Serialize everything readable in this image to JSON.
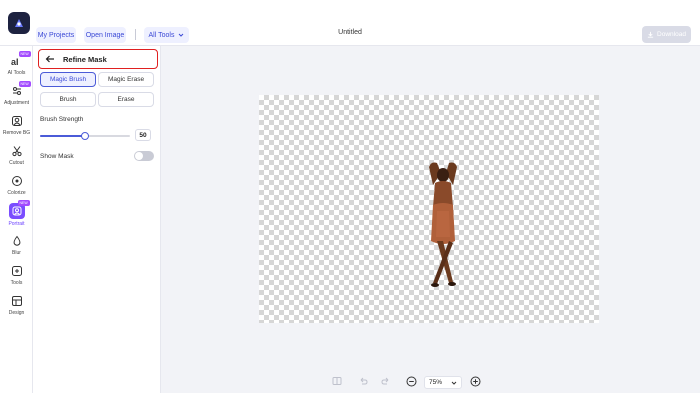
{
  "topbar": {
    "my_projects": "My Projects",
    "open_image": "Open Image",
    "all_tools": "All Tools",
    "doc_title": "Untitled",
    "download": "Download"
  },
  "nav": {
    "items": [
      {
        "label": "AI Tools",
        "icon": "ai-icon",
        "badge": "NEW"
      },
      {
        "label": "Adjustment",
        "icon": "sliders-icon",
        "badge": "NEW"
      },
      {
        "label": "Remove BG",
        "icon": "remove-bg-icon"
      },
      {
        "label": "Cutout",
        "icon": "scissors-icon"
      },
      {
        "label": "Colorize",
        "icon": "colorize-icon"
      },
      {
        "label": "Portrait",
        "icon": "portrait-icon",
        "badge": "NEW",
        "active": true
      },
      {
        "label": "Blur",
        "icon": "blur-icon"
      },
      {
        "label": "Tools",
        "icon": "tools-icon"
      },
      {
        "label": "Design",
        "icon": "design-icon"
      }
    ]
  },
  "panel": {
    "title": "Refine Mask",
    "magic_brush": "Magic Brush",
    "magic_erase": "Magic Erase",
    "brush": "Brush",
    "erase": "Erase",
    "brush_strength_label": "Brush Strength",
    "brush_strength_value": "50",
    "brush_strength_fraction": 0.5,
    "show_mask_label": "Show Mask",
    "show_mask_on": false
  },
  "zoom": {
    "value": "75%"
  },
  "colors": {
    "accent": "#4b5bd8",
    "badge": "#a34bff",
    "highlight_border": "#e02020"
  }
}
